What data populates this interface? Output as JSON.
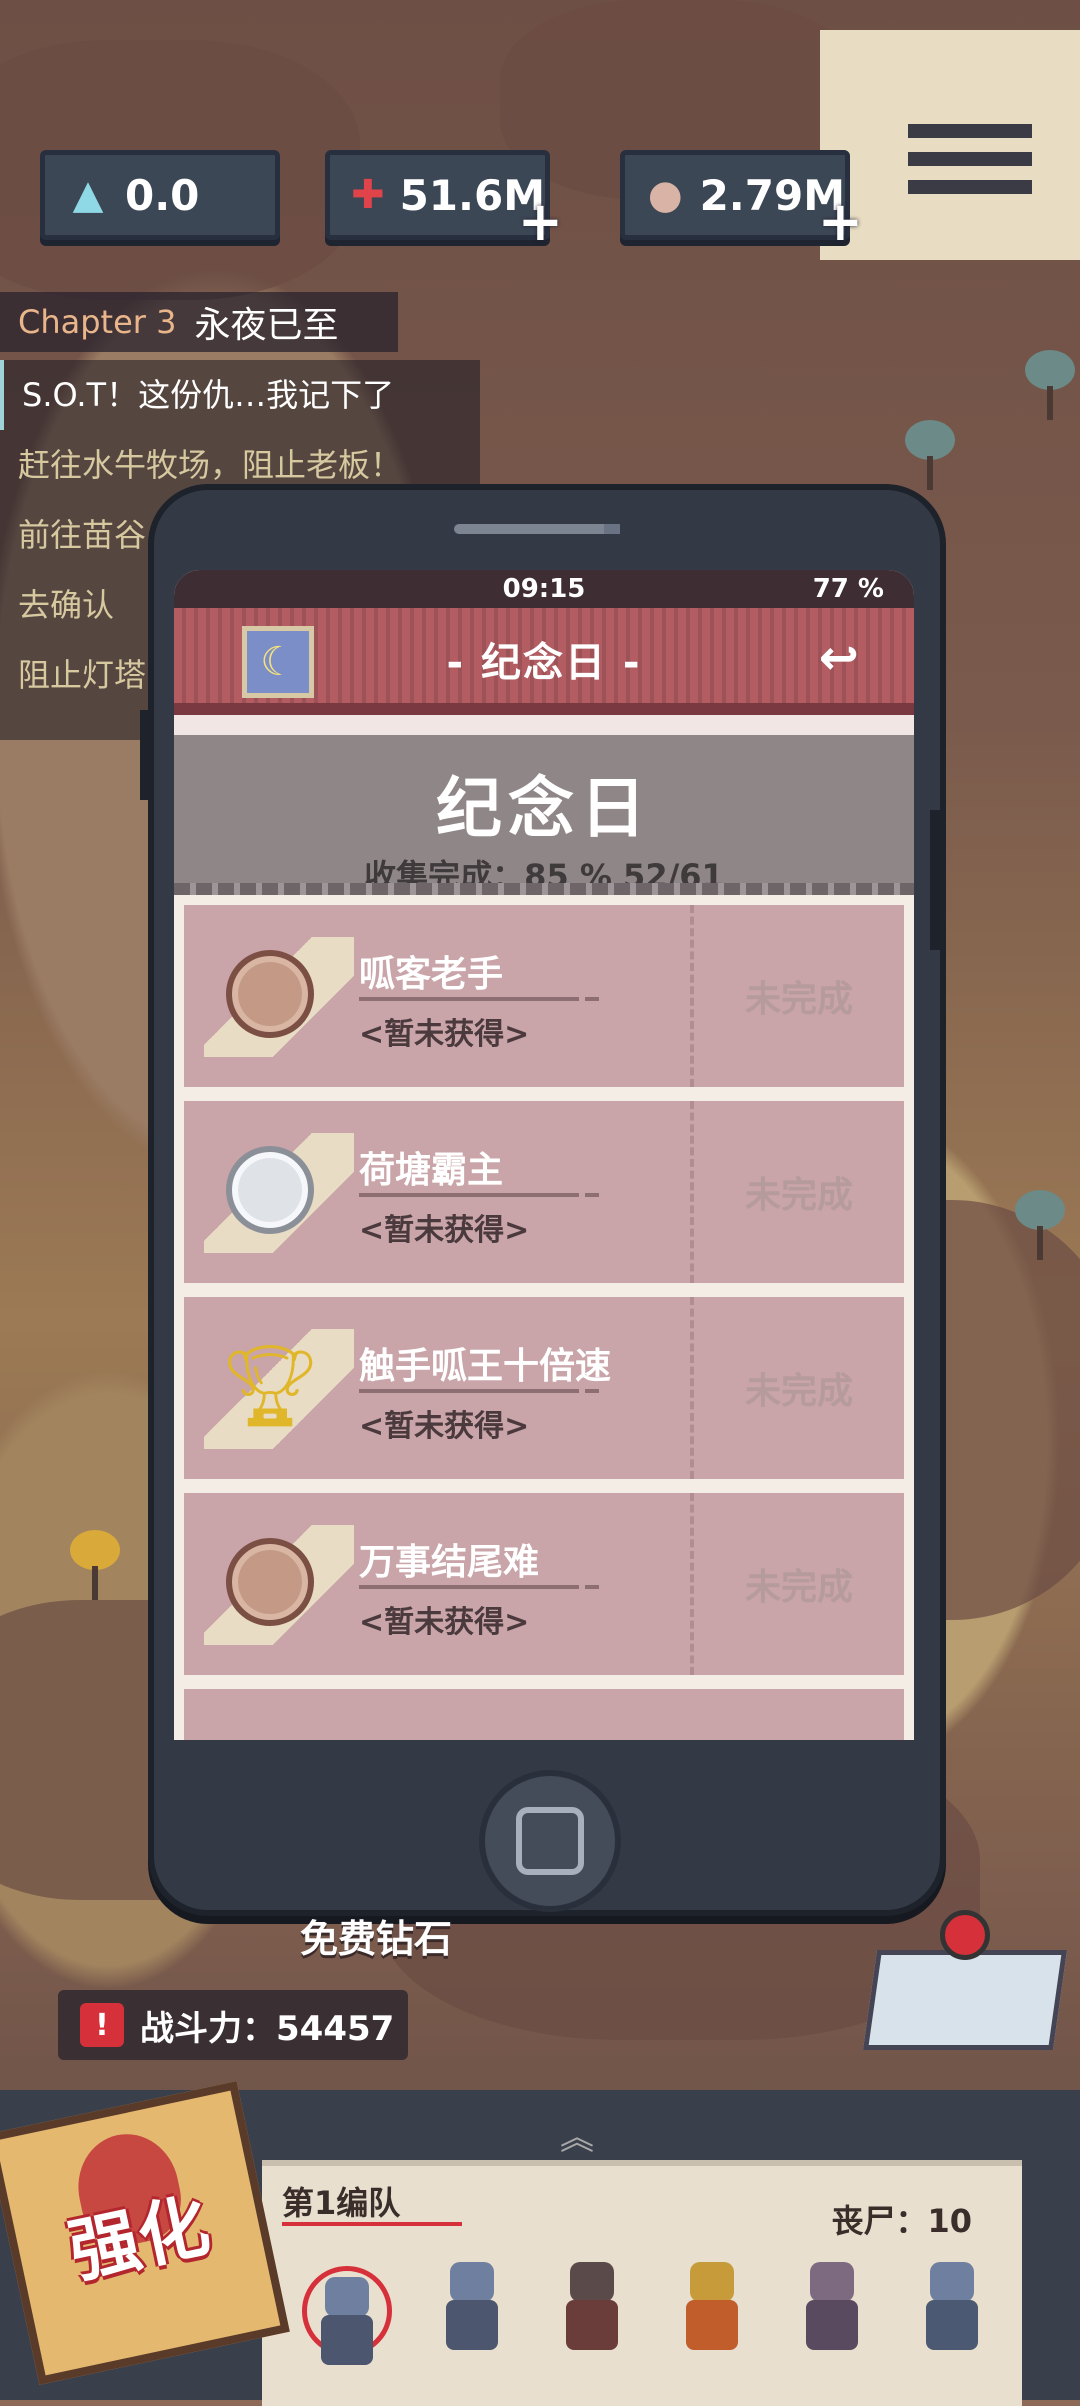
{
  "resources": [
    {
      "icon": "crystal-icon",
      "value": "0.0"
    },
    {
      "icon": "dna-icon",
      "value": "51.6M"
    },
    {
      "icon": "brain-icon",
      "value": "2.79M"
    }
  ],
  "chapter": {
    "number": "Chapter 3",
    "name": "永夜已至"
  },
  "quests": [
    "S.O.T！这份仇…我记下了",
    "赶往水牛牧场，阻止老板！",
    "前往苗谷",
    "去确认",
    "阻止灯塔"
  ],
  "phone": {
    "time": "09:15",
    "battery": "77 %",
    "title": "- 纪念日 -",
    "header": "纪念日",
    "progress": "收集完成：85 %  52/61",
    "cards": [
      {
        "name": "呱客老手",
        "status": "<暂未获得>",
        "state": "未完成",
        "medal": "bronze-medal-icon"
      },
      {
        "name": "荷塘霸主",
        "status": "<暂未获得>",
        "state": "未完成",
        "medal": "silver-medal-icon"
      },
      {
        "name": "触手呱王十倍速",
        "status": "<暂未获得>",
        "state": "未完成",
        "medal": "trophy-icon"
      },
      {
        "name": "万事结尾难",
        "status": "<暂未获得>",
        "state": "未完成",
        "medal": "bronze-medal-icon"
      }
    ]
  },
  "free_diamond": "免费钻石",
  "power": {
    "label": "战斗力：54457"
  },
  "strengthen": "强化",
  "squad": {
    "label": "第1编队",
    "count_label": "丧尸：10"
  }
}
